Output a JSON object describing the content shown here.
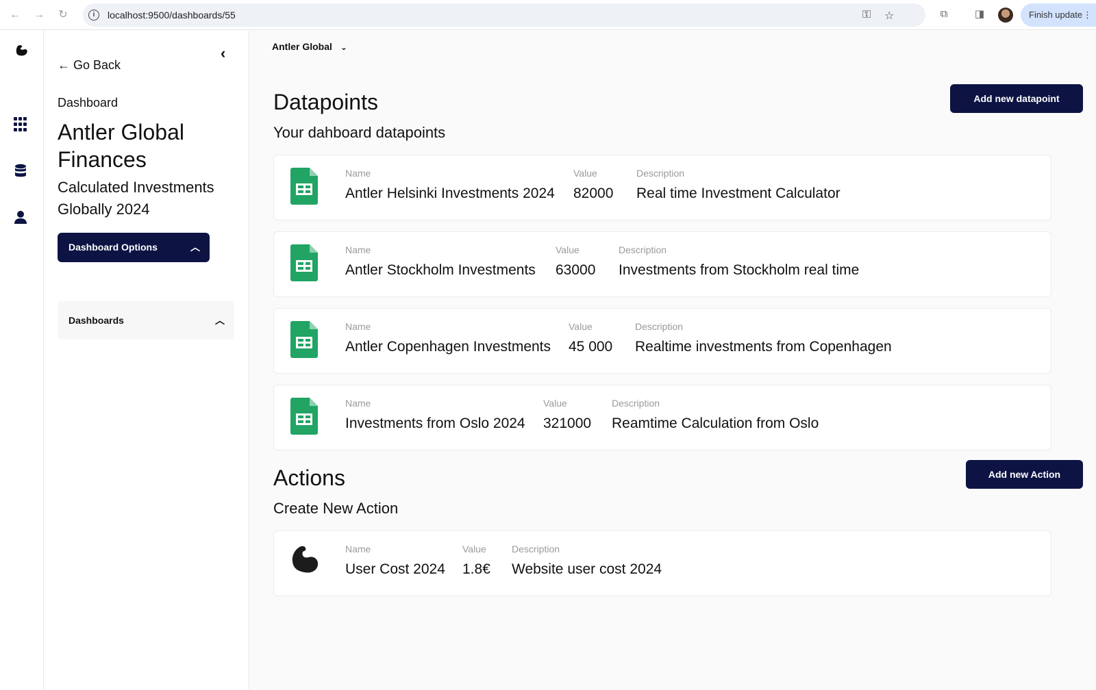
{
  "browser": {
    "url": "localhost:9500/dashboards/55",
    "finish_update": "Finish update"
  },
  "sidebar": {
    "go_back": "Go Back",
    "label": "Dashboard",
    "title": "Antler Global Finances",
    "subtitle": "Calculated Investments Globally 2024",
    "options_button": "Dashboard Options",
    "dashboards_panel": "Dashboards"
  },
  "header": {
    "org": "Antler Global"
  },
  "datapoints": {
    "title": "Datapoints",
    "subtitle": "Your dahboard datapoints",
    "add_button": "Add new datapoint",
    "labels": {
      "name": "Name",
      "value": "Value",
      "description": "Description"
    },
    "items": [
      {
        "name": "Antler Helsinki Investments 2024",
        "value": "82000",
        "description": "Real time Investment Calculator"
      },
      {
        "name": "Antler Stockholm Investments",
        "value": "63000",
        "description": "Investments from Stockholm real time"
      },
      {
        "name": "Antler Copenhagen Investments",
        "value": "45 000",
        "description": "Realtime investments from Copenhagen"
      },
      {
        "name": "Investments from Oslo 2024",
        "value": "321000",
        "description": "Reamtime Calculation from Oslo"
      }
    ]
  },
  "actions": {
    "title": "Actions",
    "subtitle": "Create New Action",
    "add_button": "Add new Action",
    "labels": {
      "name": "Name",
      "value": "Value",
      "description": "Description"
    },
    "items": [
      {
        "name": "User Cost 2024",
        "value": "1.8€",
        "description": "Website user cost 2024"
      }
    ]
  }
}
